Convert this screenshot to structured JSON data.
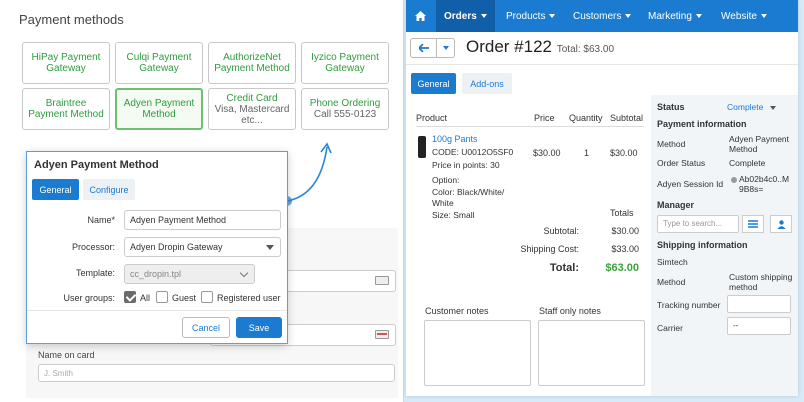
{
  "left": {
    "title": "Payment methods",
    "cards": [
      {
        "label": "HiPay Payment Gateway"
      },
      {
        "label": "Culqi Payment Gateway"
      },
      {
        "label": "AuthorizeNet Payment Method"
      },
      {
        "label": "Iyzico Payment Gateway"
      },
      {
        "label": "Braintree Payment Method"
      },
      {
        "label": "Adyen Payment Method"
      },
      {
        "label": "Credit Card",
        "sub": "Visa, Mastercard etc..."
      },
      {
        "label": "Phone Ordering",
        "sub": "Call 555-0123"
      }
    ],
    "name_on_card_label": "Name on card",
    "name_on_card_placeholder": "J. Smith"
  },
  "dialog": {
    "title": "Adyen Payment Method",
    "tabs": {
      "general": "General",
      "configure": "Configure"
    },
    "name_label": "Name*",
    "name_value": "Adyen Payment Method",
    "processor_label": "Processor:",
    "processor_value": "Adyen Dropin Gateway",
    "template_label": "Template:",
    "template_value": "cc_dropin.tpl",
    "usergroups_label": "User groups:",
    "usergroups": [
      {
        "label": "All",
        "checked": true
      },
      {
        "label": "Guest",
        "checked": false
      },
      {
        "label": "Registered user",
        "checked": false
      }
    ],
    "cancel": "Cancel",
    "save": "Save"
  },
  "right": {
    "nav": [
      "Orders",
      "Products",
      "Customers",
      "Marketing",
      "Website"
    ],
    "order_title": "Order #122",
    "order_total": "Total: $63.00",
    "tabs": {
      "general": "General",
      "addons": "Add-ons"
    },
    "table_headers": {
      "product": "Product",
      "price": "Price",
      "quantity": "Quantity",
      "subtotal": "Subtotal"
    },
    "product": {
      "name": "100g Pants",
      "code": "CODE: U0012O5SF0",
      "points": "Price in points: 30",
      "option_label": "Option:",
      "color": "Color: Black/White/",
      "color2": "White",
      "size": "Size: Small",
      "price": "$30.00",
      "quantity": "1",
      "subtotal": "$30.00"
    },
    "totals": {
      "heading": "Totals",
      "subtotal_label": "Subtotal:",
      "subtotal": "$30.00",
      "shipping_label": "Shipping Cost:",
      "shipping": "$33.00",
      "total_label": "Total:",
      "total": "$63.00"
    },
    "customer_notes": "Customer notes",
    "staff_notes": "Staff only notes",
    "sidebar": {
      "status_label": "Status",
      "status_value": "Complete",
      "payment_info": "Payment information",
      "method_label": "Method",
      "method_value": "Adyen Payment",
      "method_value2": "Method",
      "order_status_label": "Order Status",
      "order_status_value": "Complete",
      "session_label": "Adyen Session Id",
      "session_value": "Ab02b4c0..M",
      "session_value2": "9B8s=",
      "manager": "Manager",
      "manager_placeholder": "Type to search...",
      "shipping_info": "Shipping information",
      "carrier_name": "Simtech",
      "ship_method_label": "Method",
      "ship_method_value": "Custom shipping",
      "ship_method_value2": "method",
      "tracking_label": "Tracking number",
      "carrier_label": "Carrier",
      "carrier_value": "--"
    }
  },
  "colors": {
    "accent": "#1a7bd1",
    "green": "#2e9d3e",
    "total_green": "#3aa33a"
  }
}
